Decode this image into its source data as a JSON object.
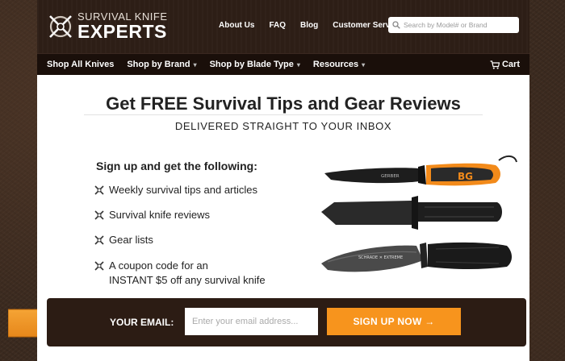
{
  "header": {
    "logo": {
      "top": "SURVIVAL KNIFE",
      "bottom": "EXPERTS"
    },
    "links": [
      "About Us",
      "FAQ",
      "Blog",
      "Customer Service"
    ],
    "search": {
      "placeholder": "Search by Model# or Brand",
      "icon": "search-icon"
    }
  },
  "nav": {
    "items": [
      {
        "label": "Shop All Knives",
        "dropdown": false
      },
      {
        "label": "Shop by Brand",
        "dropdown": true
      },
      {
        "label": "Shop by Blade Type",
        "dropdown": true
      },
      {
        "label": "Resources",
        "dropdown": true
      }
    ],
    "cart_label": "Cart",
    "caret": "▾"
  },
  "main": {
    "headline": "Get FREE Survival Tips and Gear Reviews",
    "subheadline": "DELIVERED STRAIGHT TO YOUR INBOX",
    "signup_title": "Sign up and get the following:",
    "benefits": [
      "Weekly survival tips and articles",
      "Survival knife reviews",
      "Gear lists",
      "A coupon code for an",
      "INSTANT $5 off any survival knife"
    ],
    "knife_brands": [
      "GERBER",
      "BG",
      "SCHRADE ✕ EXTREME"
    ]
  },
  "email_bar": {
    "label": "YOUR EMAIL:",
    "placeholder": "Enter your email address...",
    "button_label": "SIGN UP NOW →"
  },
  "colors": {
    "accent": "#f7941d",
    "header_bg": "#2d1e16",
    "nav_bg": "#1a0f0a",
    "email_bar_bg": "#2c1c14"
  }
}
